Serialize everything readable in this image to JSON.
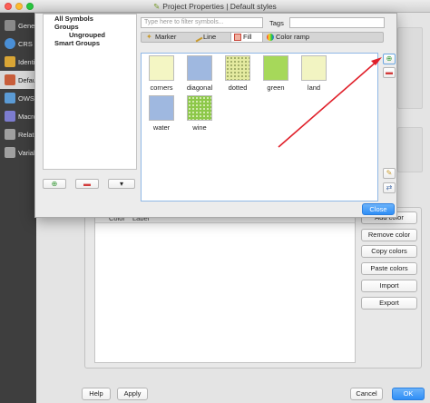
{
  "window": {
    "title": "Project Properties | Default styles"
  },
  "sidebar": {
    "items": [
      {
        "label": "General",
        "icon": "general-icon",
        "color": "#8a8a8a"
      },
      {
        "label": "CRS",
        "icon": "globe-icon",
        "color": "#4a8fd6"
      },
      {
        "label": "Identify layers",
        "icon": "identify-icon",
        "color": "#d9a535"
      },
      {
        "label": "Default styles",
        "icon": "styles-icon",
        "color": "#c85d3a"
      },
      {
        "label": "OWS server",
        "icon": "ows-icon",
        "color": "#5b9bd5"
      },
      {
        "label": "Macros",
        "icon": "macros-icon",
        "color": "#7c7cd0"
      },
      {
        "label": "Relations",
        "icon": "relations-icon",
        "color": "#a0a0a0"
      },
      {
        "label": "Variables",
        "icon": "variables-icon",
        "color": "#a0a0a0"
      }
    ]
  },
  "palette": {
    "headers": {
      "color": "Color",
      "label": "Label"
    },
    "buttons": {
      "add": "Add color",
      "remove": "Remove color",
      "copy": "Copy colors",
      "paste": "Paste colors",
      "import": "Import",
      "export": "Export"
    }
  },
  "footer": {
    "help": "Help",
    "apply": "Apply",
    "cancel": "Cancel",
    "ok": "OK"
  },
  "symbols_dialog": {
    "groups": {
      "all": "All Symbols",
      "groups": "Groups",
      "ungrouped": "Ungrouped",
      "smart": "Smart Groups"
    },
    "filter_placeholder": "Type here to filter symbols...",
    "tags_label": "Tags",
    "tabs": [
      {
        "label": "Marker",
        "icon": "marker-icon"
      },
      {
        "label": "Line",
        "icon": "line-icon"
      },
      {
        "label": "Fill",
        "icon": "fill-icon"
      },
      {
        "label": "Color ramp",
        "icon": "color-ramp-icon"
      }
    ],
    "active_tab": "Fill",
    "symbols": [
      {
        "label": "corners",
        "color": "#f4f6c4"
      },
      {
        "label": "diagonal",
        "color": "#9fb8e0"
      },
      {
        "label": "dotted",
        "color": "#e4eaa0"
      },
      {
        "label": "green",
        "color": "#a6d85a"
      },
      {
        "label": "land",
        "color": "#f2f4c2"
      },
      {
        "label": "water",
        "color": "#9fb8e0"
      },
      {
        "label": "wine",
        "color": "#8dc84a"
      }
    ],
    "close": "Close",
    "accent": "#2f8ef6",
    "arrow_color": "#e0202a"
  }
}
